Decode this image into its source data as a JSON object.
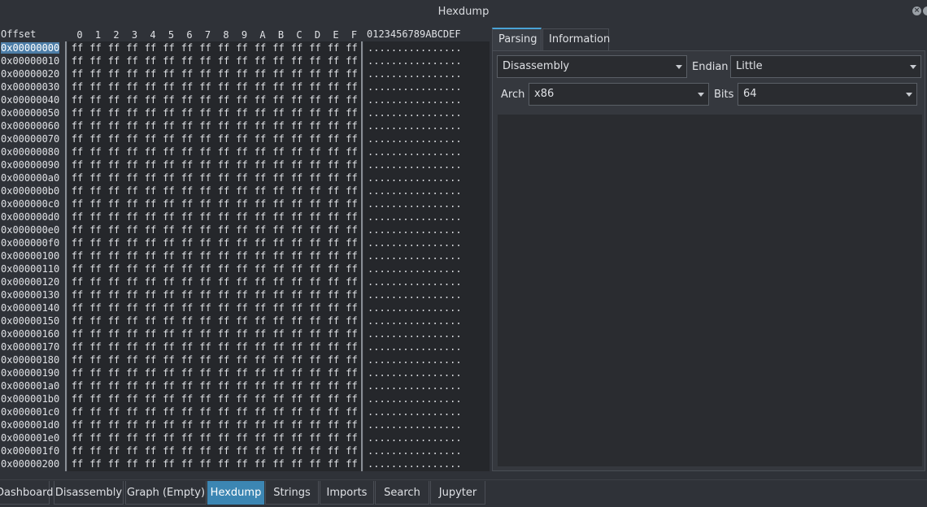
{
  "window": {
    "title": "Hexdump"
  },
  "hexdump": {
    "header": {
      "offset_label": "Offset",
      "columns": [
        "0",
        "1",
        "2",
        "3",
        "4",
        "5",
        "6",
        "7",
        "8",
        "9",
        "A",
        "B",
        "C",
        "D",
        "E",
        "F"
      ],
      "ascii_label": "0123456789ABCDEF"
    },
    "offsets": [
      "0x00000000",
      "0x00000010",
      "0x00000020",
      "0x00000030",
      "0x00000040",
      "0x00000050",
      "0x00000060",
      "0x00000070",
      "0x00000080",
      "0x00000090",
      "0x000000a0",
      "0x000000b0",
      "0x000000c0",
      "0x000000d0",
      "0x000000e0",
      "0x000000f0",
      "0x00000100",
      "0x00000110",
      "0x00000120",
      "0x00000130",
      "0x00000140",
      "0x00000150",
      "0x00000160",
      "0x00000170",
      "0x00000180",
      "0x00000190",
      "0x000001a0",
      "0x000001b0",
      "0x000001c0",
      "0x000001d0",
      "0x000001e0",
      "0x000001f0",
      "0x00000200"
    ],
    "selected_offset": "0x00000000",
    "byte_value": "ff",
    "ascii_row": "................"
  },
  "parsing_panel": {
    "tabs": [
      {
        "label": "Parsing",
        "active": true
      },
      {
        "label": "Information",
        "active": false
      }
    ],
    "mode_select": {
      "value": "Disassembly"
    },
    "endian_label": "Endian",
    "endian_select": {
      "value": "Little"
    },
    "arch_label": "Arch",
    "arch_select": {
      "value": "x86"
    },
    "bits_label": "Bits",
    "bits_select": {
      "value": "64"
    }
  },
  "bottom_tabs": [
    {
      "label": "Dashboard",
      "active": false
    },
    {
      "label": "Disassembly",
      "active": false
    },
    {
      "label": "Graph (Empty)",
      "active": false
    },
    {
      "label": "Hexdump",
      "active": true
    },
    {
      "label": "Strings",
      "active": false
    },
    {
      "label": "Imports",
      "active": false
    },
    {
      "label": "Search",
      "active": false
    },
    {
      "label": "Jupyter",
      "active": false
    }
  ],
  "colors": {
    "accent": "#3c86b3",
    "selection": "#4d7ea8",
    "background": "#2f3238"
  }
}
